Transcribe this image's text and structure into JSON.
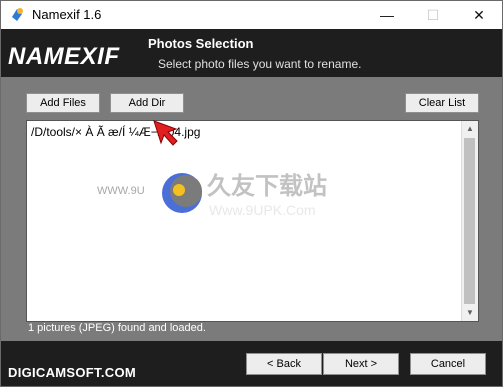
{
  "window": {
    "title": "Namexif 1.6"
  },
  "window_controls": {
    "minimize": "—",
    "maximize": "☐",
    "close": "✕"
  },
  "header": {
    "brand": "NAMEXIF",
    "title": "Photos Selection",
    "subtitle": "Select photo files you want to rename."
  },
  "toolbar": {
    "add_files": "Add Files",
    "add_dir": "Add Dir",
    "clear_list": "Clear List"
  },
  "file_list": {
    "items": [
      "/D/tools/× À Ã æ/Í  ¼Æ−/004.jpg"
    ]
  },
  "status": {
    "text": "1 pictures (JPEG) found and loaded."
  },
  "footer": {
    "brand": "DIGICAMSOFT.COM",
    "back": "< Back",
    "next": "Next >",
    "cancel": "Cancel"
  },
  "watermark": {
    "logo_text": "久友下载站",
    "url": "Www.9UPK.Com",
    "left_text": "WWW.9U"
  },
  "colors": {
    "header_bg": "#1e1e1e",
    "content_bg": "#7b7b7b",
    "pointer": "#e02020"
  }
}
